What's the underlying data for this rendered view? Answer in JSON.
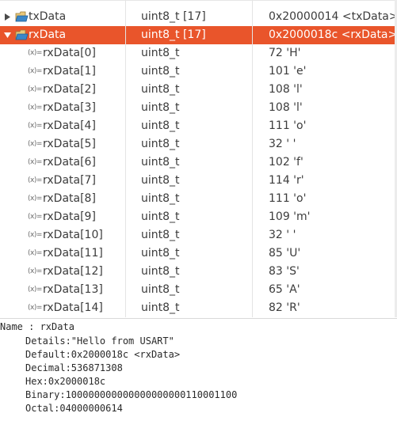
{
  "tree": {
    "rows": [
      {
        "name": "txData",
        "type": "uint8_t [17]",
        "value": "0x20000014 <txData>"
      },
      {
        "name": "rxData",
        "type": "uint8_t [17]",
        "value": "0x2000018c <rxData>"
      },
      {
        "name": "rxData[0]",
        "type": "uint8_t",
        "value": "72 'H'"
      },
      {
        "name": "rxData[1]",
        "type": "uint8_t",
        "value": "101 'e'"
      },
      {
        "name": "rxData[2]",
        "type": "uint8_t",
        "value": "108 'l'"
      },
      {
        "name": "rxData[3]",
        "type": "uint8_t",
        "value": "108 'l'"
      },
      {
        "name": "rxData[4]",
        "type": "uint8_t",
        "value": "111 'o'"
      },
      {
        "name": "rxData[5]",
        "type": "uint8_t",
        "value": "32 ' '"
      },
      {
        "name": "rxData[6]",
        "type": "uint8_t",
        "value": "102 'f'"
      },
      {
        "name": "rxData[7]",
        "type": "uint8_t",
        "value": "114 'r'"
      },
      {
        "name": "rxData[8]",
        "type": "uint8_t",
        "value": "111 'o'"
      },
      {
        "name": "rxData[9]",
        "type": "uint8_t",
        "value": "109 'm'"
      },
      {
        "name": "rxData[10]",
        "type": "uint8_t",
        "value": "32 ' '"
      },
      {
        "name": "rxData[11]",
        "type": "uint8_t",
        "value": "85 'U'"
      },
      {
        "name": "rxData[12]",
        "type": "uint8_t",
        "value": "83 'S'"
      },
      {
        "name": "rxData[13]",
        "type": "uint8_t",
        "value": "65 'A'"
      },
      {
        "name": "rxData[14]",
        "type": "uint8_t",
        "value": "82 'R'"
      }
    ],
    "element_icon_label": "(x)="
  },
  "details": {
    "name_line": "Name : rxData",
    "details_line": "Details:\"Hello from USART\"",
    "default_line": "Default:0x2000018c <rxData>",
    "decimal_line": "Decimal:536871308",
    "hex_line": "Hex:0x2000018c",
    "binary_line": "Binary:100000000000000000000110001100",
    "octal_line": "Octal:04000000614"
  },
  "colors": {
    "selection": "#e9552b",
    "folder_icon_blue": "#3a87c9",
    "folder_icon_tan": "#e8c77a"
  }
}
